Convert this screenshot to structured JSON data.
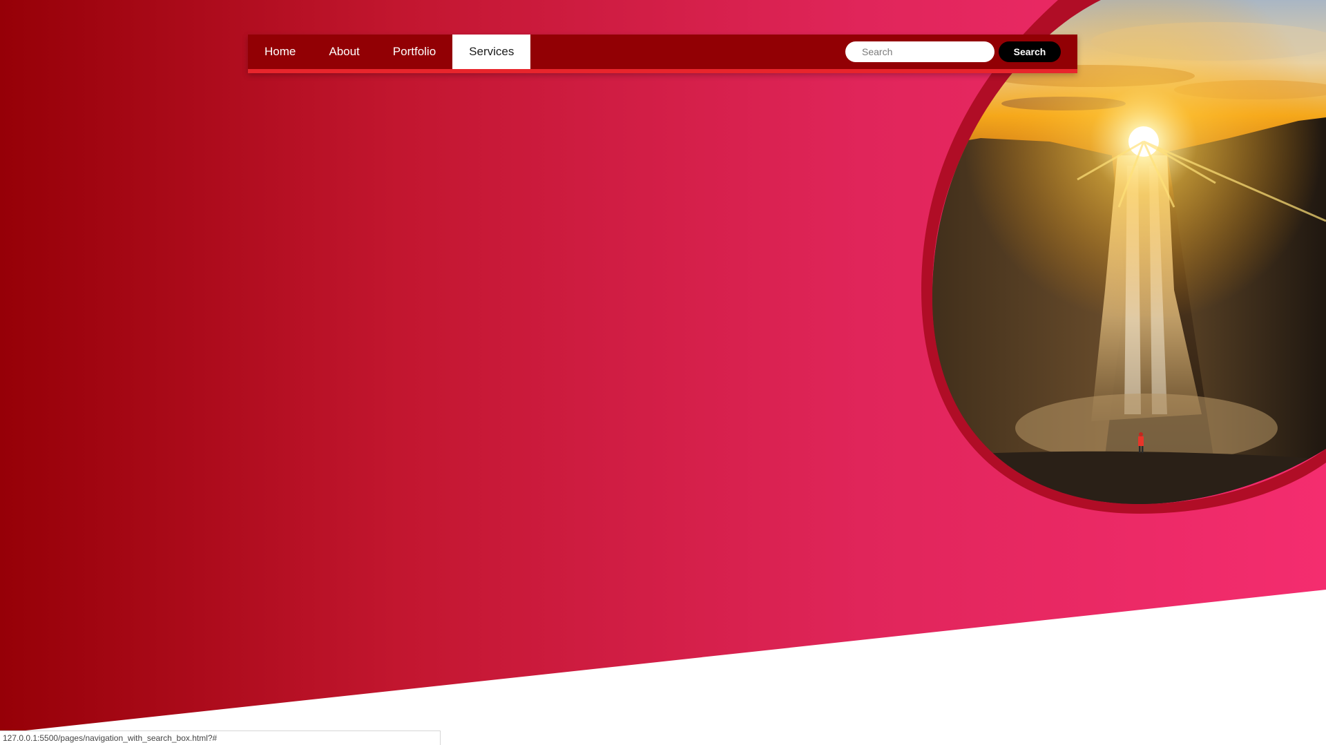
{
  "nav": {
    "items": [
      {
        "label": "Home",
        "active": false
      },
      {
        "label": "About",
        "active": false
      },
      {
        "label": "Portfolio",
        "active": false
      },
      {
        "label": "Services",
        "active": true
      }
    ],
    "search": {
      "placeholder": "Search",
      "value": "",
      "button_label": "Search"
    }
  },
  "colors": {
    "gradient_start": "#960007",
    "gradient_end": "#f42d6f",
    "nav_background": "#920004",
    "nav_border": "#e8252c",
    "search_button": "#000000"
  },
  "status_bar": {
    "url": "127.0.0.1:5500/pages/navigation_with_search_box.html?#"
  }
}
